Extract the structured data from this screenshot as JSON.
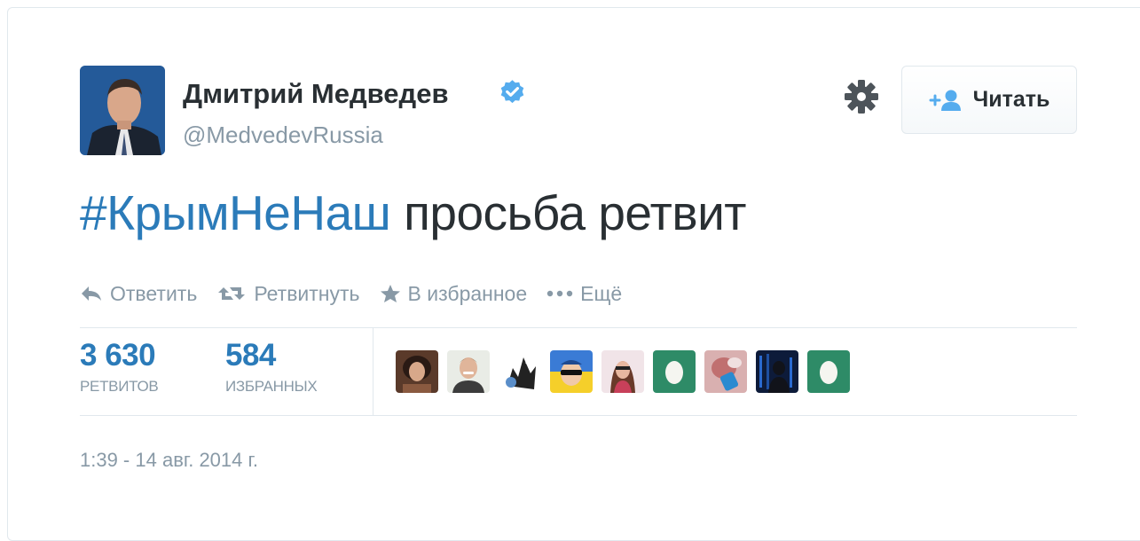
{
  "tweet": {
    "author_name": "Дмитрий Медведев",
    "handle": "@MedvedevRussia",
    "hashtag": "#КрымНеНаш",
    "text_rest": " просьба ретвит",
    "timestamp": "1:39 - 14 авг. 2014 г."
  },
  "header": {
    "follow_label": "Читать"
  },
  "actions": {
    "reply": "Ответить",
    "retweet": "Ретвитнуть",
    "favorite": "В избранное",
    "more": "Ещё"
  },
  "stats": {
    "retweets_count": "3 630",
    "retweets_label": "РЕТВИТОВ",
    "favorites_count": "584",
    "favorites_label": "ИЗБРАННЫХ"
  },
  "colors": {
    "link_blue": "#2b7bb9",
    "verified_blue": "#55acee",
    "text_dark": "#292f33",
    "text_muted": "#8899a6",
    "egg_green": "#2e8b67"
  },
  "icons": {
    "verified": "verified-badge-icon",
    "gear": "gear-icon",
    "follow": "add-user-icon",
    "reply": "reply-icon",
    "retweet": "retweet-icon",
    "favorite": "star-icon",
    "more": "ellipsis-icon"
  }
}
